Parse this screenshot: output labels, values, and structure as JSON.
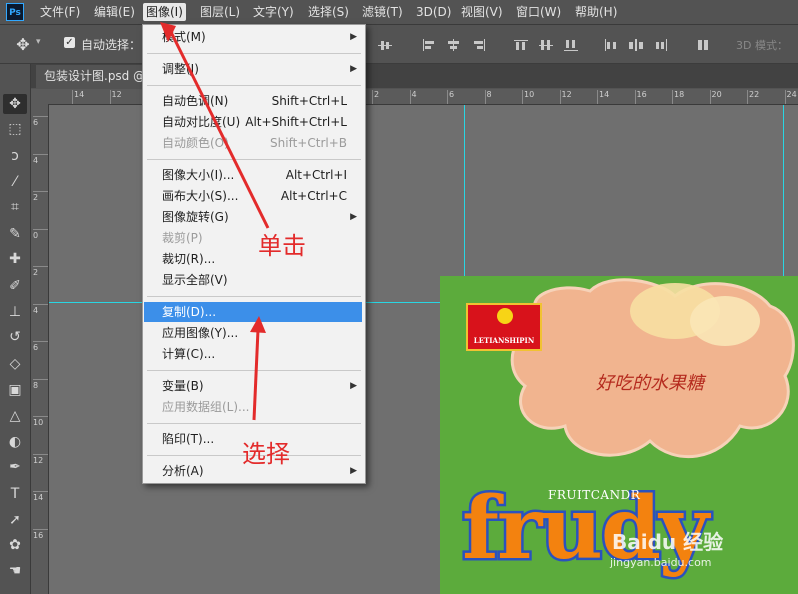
{
  "app": {
    "logo_text": "Ps"
  },
  "menubar": {
    "items": [
      "文件(F)",
      "编辑(E)",
      "图像(I)",
      "图层(L)",
      "文字(Y)",
      "选择(S)",
      "滤镜(T)",
      "3D(D)",
      "视图(V)",
      "窗口(W)",
      "帮助(H)"
    ],
    "active_index": 2
  },
  "options_bar": {
    "auto_select_label": "自动选择：",
    "auto_select_checked": true,
    "mode_label": "3D 模式："
  },
  "document": {
    "tab_title": "包装设计图.psd @"
  },
  "rulers": {
    "h_labels": [
      "14",
      "12",
      "10",
      "8",
      "6",
      "4",
      "2",
      "0",
      "2",
      "4",
      "6",
      "8",
      "10",
      "12",
      "14",
      "16",
      "18",
      "20",
      "22",
      "24",
      "26"
    ],
    "v_labels": [
      "6",
      "4",
      "2",
      "0",
      "2",
      "4",
      "6",
      "8",
      "10",
      "12",
      "14",
      "16"
    ]
  },
  "image_menu": {
    "items": [
      {
        "label": "模式(M)",
        "shortcut": "",
        "submenu": true,
        "disabled": false
      },
      {
        "sep": true
      },
      {
        "label": "调整(J)",
        "shortcut": "",
        "submenu": true,
        "disabled": false
      },
      {
        "sep": true
      },
      {
        "label": "自动色调(N)",
        "shortcut": "Shift+Ctrl+L",
        "submenu": false,
        "disabled": false
      },
      {
        "label": "自动对比度(U)",
        "shortcut": "Alt+Shift+Ctrl+L",
        "submenu": false,
        "disabled": false
      },
      {
        "label": "自动颜色(O)",
        "shortcut": "Shift+Ctrl+B",
        "submenu": false,
        "disabled": true
      },
      {
        "sep": true
      },
      {
        "label": "图像大小(I)...",
        "shortcut": "Alt+Ctrl+I",
        "submenu": false,
        "disabled": false
      },
      {
        "label": "画布大小(S)...",
        "shortcut": "Alt+Ctrl+C",
        "submenu": false,
        "disabled": false
      },
      {
        "label": "图像旋转(G)",
        "shortcut": "",
        "submenu": true,
        "disabled": false
      },
      {
        "label": "裁剪(P)",
        "shortcut": "",
        "submenu": false,
        "disabled": true
      },
      {
        "label": "裁切(R)...",
        "shortcut": "",
        "submenu": false,
        "disabled": false
      },
      {
        "label": "显示全部(V)",
        "shortcut": "",
        "submenu": false,
        "disabled": false
      },
      {
        "sep": true
      },
      {
        "label": "复制(D)...",
        "shortcut": "",
        "submenu": false,
        "disabled": false,
        "highlight": true
      },
      {
        "label": "应用图像(Y)...",
        "shortcut": "",
        "submenu": false,
        "disabled": false
      },
      {
        "label": "计算(C)...",
        "shortcut": "",
        "submenu": false,
        "disabled": false
      },
      {
        "sep": true
      },
      {
        "label": "变量(B)",
        "shortcut": "",
        "submenu": true,
        "disabled": false
      },
      {
        "label": "应用数据组(L)...",
        "shortcut": "",
        "submenu": false,
        "disabled": true
      },
      {
        "sep": true
      },
      {
        "label": "陷印(T)...",
        "shortcut": "",
        "submenu": false,
        "disabled": false
      },
      {
        "sep": true
      },
      {
        "label": "分析(A)",
        "shortcut": "",
        "submenu": true,
        "disabled": false
      }
    ]
  },
  "artwork": {
    "brand": "LETIANSHIPIN",
    "tagline": "好吃的水果糖",
    "subtitle": "FRUITCANDR",
    "product_name": "frudy",
    "watermark_1": "Baidu 经验",
    "watermark_2": "jingyan.baidu.com"
  },
  "annotations": {
    "click": "单击",
    "select": "选择",
    "color": "#e32b2b"
  }
}
